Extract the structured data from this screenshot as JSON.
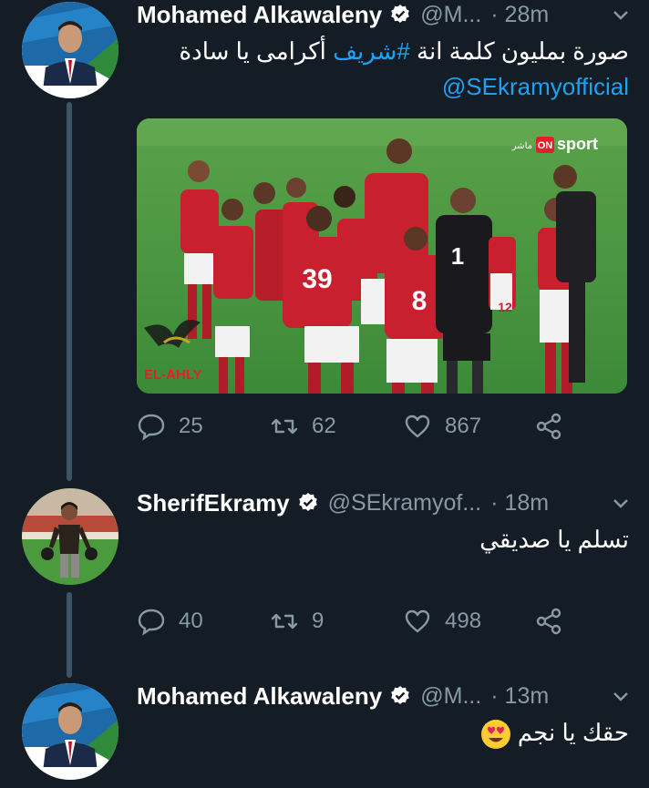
{
  "tweets": [
    {
      "name": "Mohamed Alkawaleny",
      "handle": "@M...",
      "time": "· 28m",
      "text_hashtag": "#شريف",
      "text_before": "صورة بمليون كلمة انة ",
      "text_after": " أكرامى يا سادة",
      "mention": "@SEkramyofficial",
      "replies": "25",
      "retweets": "62",
      "likes": "867",
      "media": {
        "broadcaster": "ON sport",
        "live_label": "ماشر",
        "watermark": "EL-AHLY",
        "jersey_numbers": [
          "39",
          "8",
          "1",
          "12"
        ]
      }
    },
    {
      "name": "SherifEkramy",
      "handle": "@SEkramyof...",
      "time": "· 18m",
      "text": "تسلم يا صديقي",
      "replies": "40",
      "retweets": "9",
      "likes": "498"
    },
    {
      "name": "Mohamed Alkawaleny",
      "handle": "@M...",
      "time": "· 13m",
      "text": "حقك يا نجم"
    }
  ],
  "colors": {
    "background": "#141d26",
    "link": "#1da1f2",
    "muted": "#8899a6",
    "jersey": "#c8202e"
  },
  "icons": [
    "verified-badge-icon",
    "chevron-down-icon",
    "reply-icon",
    "retweet-icon",
    "like-icon",
    "share-icon",
    "heart-eyes-emoji"
  ]
}
